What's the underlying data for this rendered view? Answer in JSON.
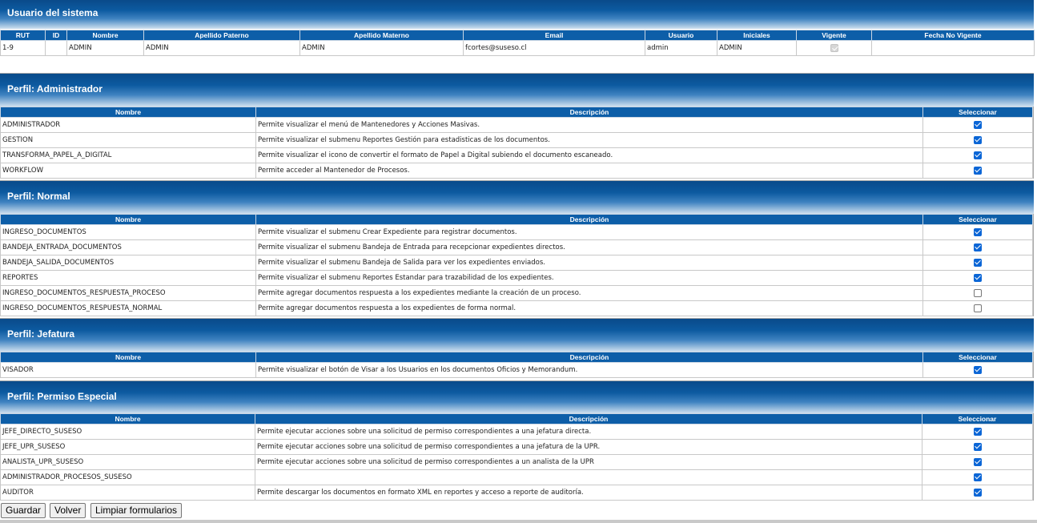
{
  "user_section": {
    "title": "Usuario del sistema",
    "headers": [
      "RUT",
      "ID",
      "Nombre",
      "Apellido Paterno",
      "Apellido Materno",
      "Email",
      "Usuario",
      "Iniciales",
      "Vigente",
      "Fecha No Vigente"
    ],
    "row": {
      "rut": "1-9",
      "id": "",
      "nombre": "ADMIN",
      "apellido_paterno": "ADMIN",
      "apellido_materno": "ADMIN",
      "email": "fcortes@suseso.cl",
      "usuario": "admin",
      "iniciales": "ADMIN",
      "vigente": true,
      "fecha_no_vigente": ""
    }
  },
  "profile_headers": {
    "nombre": "Nombre",
    "descripcion": "Descripción",
    "seleccionar": "Seleccionar"
  },
  "profiles": [
    {
      "title": "Perfil: Administrador",
      "rows": [
        {
          "nombre": "ADMINISTRADOR",
          "descripcion": "Permite visualizar el menú de Mantenedores y Acciones Masivas.",
          "checked": true
        },
        {
          "nombre": "GESTION",
          "descripcion": "Permite visualizar el submenu Reportes Gestión para estadisticas de los documentos.",
          "checked": true
        },
        {
          "nombre": "TRANSFORMA_PAPEL_A_DIGITAL",
          "descripcion": "Permite visualizar el icono de convertir el formato de Papel a Digital subiendo el documento escaneado.",
          "checked": true
        },
        {
          "nombre": "WORKFLOW",
          "descripcion": "Permite acceder al Mantenedor de Procesos.",
          "checked": true
        }
      ]
    },
    {
      "title": "Perfil: Normal",
      "rows": [
        {
          "nombre": "INGRESO_DOCUMENTOS",
          "descripcion": "Permite visualizar el submenu Crear Expediente para registrar documentos.",
          "checked": true
        },
        {
          "nombre": "BANDEJA_ENTRADA_DOCUMENTOS",
          "descripcion": "Permite visualizar el submenu Bandeja de Entrada para recepcionar expedientes directos.",
          "checked": true
        },
        {
          "nombre": "BANDEJA_SALIDA_DOCUMENTOS",
          "descripcion": "Permite visualizar el submenu Bandeja de Salida para ver los expedientes enviados.",
          "checked": true
        },
        {
          "nombre": "REPORTES",
          "descripcion": "Permite visualizar el submenu Reportes Estandar para trazabilidad de los expedientes.",
          "checked": true
        },
        {
          "nombre": "INGRESO_DOCUMENTOS_RESPUESTA_PROCESO",
          "descripcion": "Permite agregar documentos respuesta a los expedientes mediante la creación de un proceso.",
          "checked": false
        },
        {
          "nombre": "INGRESO_DOCUMENTOS_RESPUESTA_NORMAL",
          "descripcion": "Permite agregar documentos respuesta a los expedientes de forma normal.",
          "checked": false
        }
      ]
    },
    {
      "title": "Perfil: Jefatura",
      "rows": [
        {
          "nombre": "VISADOR",
          "descripcion": "Permite visualizar el botón de Visar a los Usuarios en los documentos Oficios y Memorandum.",
          "checked": true
        }
      ]
    },
    {
      "title": "Perfil: Permiso Especial",
      "rows": [
        {
          "nombre": "JEFE_DIRECTO_SUSESO",
          "descripcion": "Permite ejecutar acciones sobre una solicitud de permiso correspondientes a una jefatura directa.",
          "checked": true
        },
        {
          "nombre": "JEFE_UPR_SUSESO",
          "descripcion": "Permite ejecutar acciones sobre una solicitud de permiso correspondientes a una jefatura de la UPR.",
          "checked": true
        },
        {
          "nombre": "ANALISTA_UPR_SUSESO",
          "descripcion": "Permite ejecutar acciones sobre una solicitud de permiso correspondientes a un analista de la UPR",
          "checked": true
        },
        {
          "nombre": "ADMINISTRADOR_PROCESOS_SUSESO",
          "descripcion": "",
          "checked": true
        },
        {
          "nombre": "AUDITOR",
          "descripcion": "Permite descargar los documentos en formato XML en reportes y acceso a reporte de auditoría.",
          "checked": true
        }
      ]
    }
  ],
  "buttons": {
    "guardar": "Guardar",
    "volver": "Volver",
    "limpiar": "Limpiar formularios"
  }
}
